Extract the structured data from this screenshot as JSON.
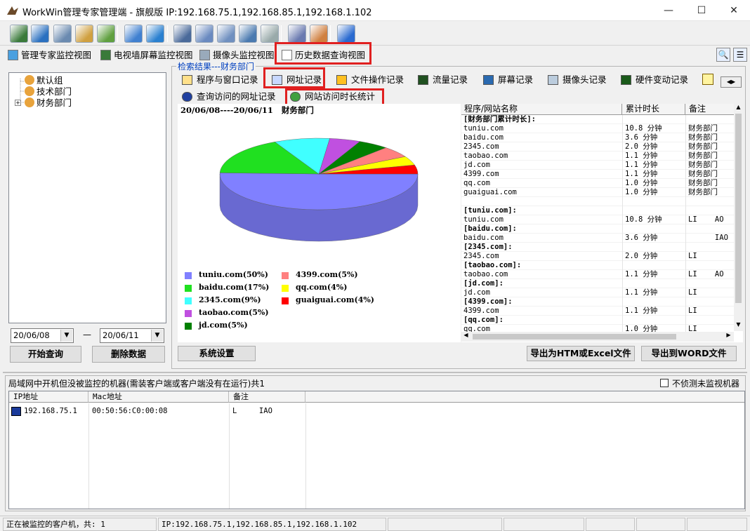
{
  "window": {
    "title": "WorkWin管理专家管理端 - 旗舰版 IP:192.168.75.1,192.168.85.1,192.168.1.102",
    "minimize": "—",
    "maximize": "☐",
    "close": "✕"
  },
  "toolbar": {
    "icons": [
      "computer-list-icon",
      "network-globe-icon",
      "settings-computer-icon",
      "mail-icon",
      "users-icon",
      "chart-icon",
      "info-icon",
      "monitor-icon",
      "remote-icon",
      "search-doc-icon",
      "windows-icon",
      "disk-icon",
      "server-icon",
      "agent-icon",
      "help-icon"
    ]
  },
  "view_tabs": [
    {
      "label": "管理专家监控视图"
    },
    {
      "label": "电视墙屏幕监控视图"
    },
    {
      "label": "摄像头监控视图"
    },
    {
      "label": "历史数据查询视图"
    }
  ],
  "tree": {
    "items": [
      "默认组",
      "技术部门",
      "财务部门"
    ],
    "expand": "+"
  },
  "dates": {
    "from": "20/06/08",
    "to": "20/06/11",
    "dash": "—"
  },
  "buttons": {
    "start_query": "开始查询",
    "delete_data": "删除数据",
    "system_settings": "系统设置",
    "export_html": "导出为HTM或Excel文件",
    "export_word": "导出到WORD文件"
  },
  "result_caption": "检索结果---财务部门",
  "func_tabs_row1": [
    "程序与窗口记录",
    "网址记录",
    "文件操作记录",
    "流量记录",
    "屏幕记录",
    "摄像头记录",
    "硬件变动记录"
  ],
  "func_tabs_row2": [
    "查询访问的网址记录",
    "网站访问时长统计"
  ],
  "chart_header": "20/06/08----20/06/11   财务部门",
  "chart_data": {
    "type": "pie",
    "title": "20/06/08----20/06/11   财务部门",
    "labels": [
      "tuniu.com",
      "baidu.com",
      "2345.com",
      "taobao.com",
      "jd.com",
      "4399.com",
      "qq.com",
      "guaiguai.com"
    ],
    "values": [
      50,
      17,
      9,
      5,
      5,
      5,
      4,
      4
    ],
    "colors": [
      "#8080ff",
      "#20e020",
      "#40ffff",
      "#c050e0",
      "#008000",
      "#ff8080",
      "#ffff00",
      "#ff0000"
    ],
    "legend": [
      {
        "text": "tuniu.com(50%)",
        "color": "#8080ff"
      },
      {
        "text": "baidu.com(17%)",
        "color": "#20e020"
      },
      {
        "text": "2345.com(9%)",
        "color": "#40ffff"
      },
      {
        "text": "taobao.com(5%)",
        "color": "#c050e0"
      },
      {
        "text": "jd.com(5%)",
        "color": "#008000"
      },
      {
        "text": "4399.com(5%)",
        "color": "#ff8080"
      },
      {
        "text": "qq.com(4%)",
        "color": "#ffff00"
      },
      {
        "text": "guaiguai.com(4%)",
        "color": "#ff0000"
      }
    ]
  },
  "list": {
    "headers": [
      "程序/网站名称",
      "累计时长",
      "备注"
    ],
    "rows": [
      [
        "[财务部门累计时长]:",
        "",
        ""
      ],
      [
        "tuniu.com",
        "10.8 分钟",
        "财务部门"
      ],
      [
        "baidu.com",
        "3.6 分钟",
        "财务部门"
      ],
      [
        "2345.com",
        "2.0 分钟",
        "财务部门"
      ],
      [
        "taobao.com",
        "1.1 分钟",
        "财务部门"
      ],
      [
        "jd.com",
        "1.1 分钟",
        "财务部门"
      ],
      [
        "4399.com",
        "1.1 分钟",
        "财务部门"
      ],
      [
        "qq.com",
        "1.0 分钟",
        "财务部门"
      ],
      [
        "guaiguai.com",
        "1.0 分钟",
        "财务部门"
      ],
      [
        "",
        "",
        ""
      ],
      [
        "[tuniu.com]:",
        "",
        ""
      ],
      [
        "tuniu.com",
        "10.8 分钟",
        "LI    AO"
      ],
      [
        "[baidu.com]:",
        "",
        ""
      ],
      [
        "baidu.com",
        "3.6 分钟",
        "      IAO"
      ],
      [
        "[2345.com]:",
        "",
        ""
      ],
      [
        "2345.com",
        "2.0 分钟",
        "LI"
      ],
      [
        "[taobao.com]:",
        "",
        ""
      ],
      [
        "taobao.com",
        "1.1 分钟",
        "LI    AO"
      ],
      [
        "[jd.com]:",
        "",
        ""
      ],
      [
        "jd.com",
        "1.1 分钟",
        "LI"
      ],
      [
        "[4399.com]:",
        "",
        ""
      ],
      [
        "4399.com",
        "1.1 分钟",
        "LI"
      ],
      [
        "[qq.com]:",
        "",
        ""
      ],
      [
        "qq.com",
        "1.0 分钟",
        "LI"
      ]
    ]
  },
  "bottom": {
    "title": "局域网中开机但没被监控的机器(需装客户端或客户端没有在运行)共1",
    "checkbox_label": "不侦测未监视机器",
    "headers": [
      "IP地址",
      "Mac地址",
      "备注"
    ],
    "rows": [
      [
        "192.168.75.1",
        "00:50:56:C0:00:08",
        "L     IAO"
      ]
    ]
  },
  "status": {
    "clients": "正在被监控的客户机，共: 1",
    "ips": "IP:192.168.75.1,192.168.85.1,192.168.1.102"
  }
}
